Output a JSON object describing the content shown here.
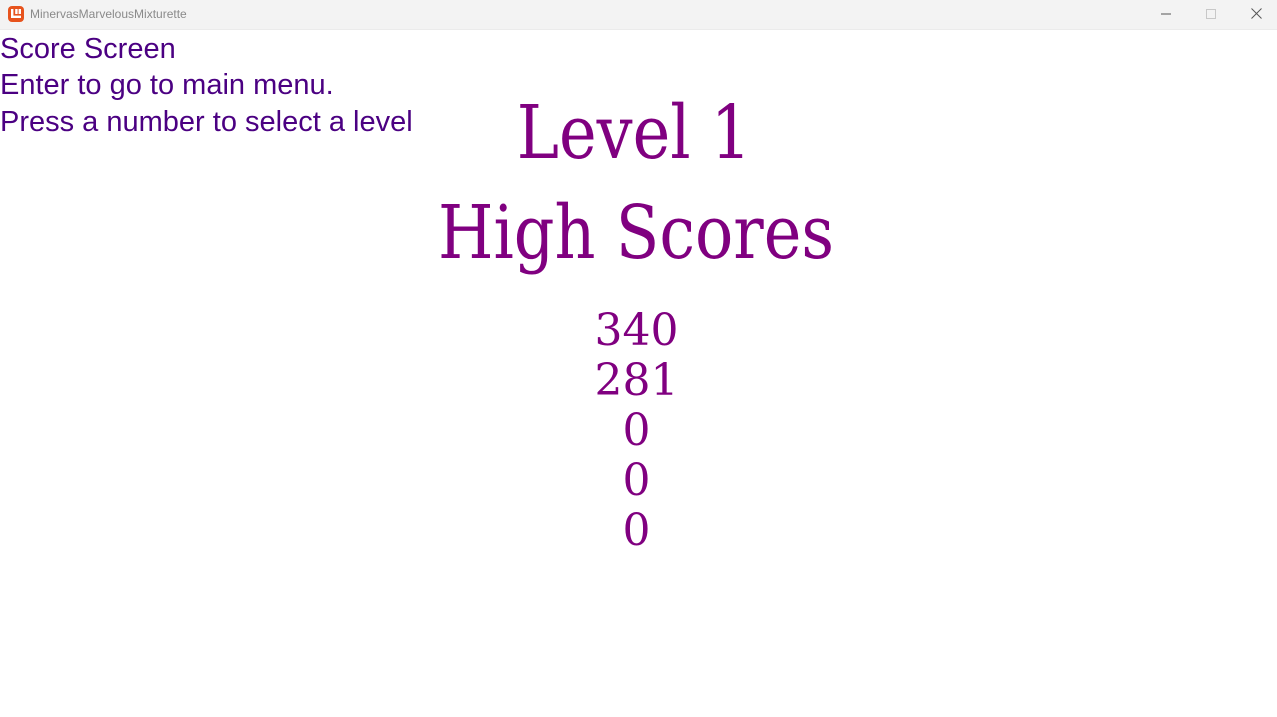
{
  "window": {
    "title": "MinervasMarvelousMixturette",
    "icon": "monogame-app-icon",
    "controls": {
      "minimize_icon": "minimize-icon",
      "maximize_icon": "maximize-icon",
      "close_icon": "close-icon"
    }
  },
  "colors": {
    "instruction_text": "#4b0082",
    "heading_text": "#800080",
    "background": "#ffffff",
    "titlebar": "#f3f3f3",
    "app_icon": "#e7531d"
  },
  "instructions": {
    "line1": "Score Screen",
    "line2": "Enter to go to main menu.",
    "line3": "Press a number to select a level"
  },
  "level_title": "Level 1",
  "high_scores_title": "High Scores",
  "high_scores": [
    "340",
    "281",
    "0",
    "0",
    "0"
  ]
}
